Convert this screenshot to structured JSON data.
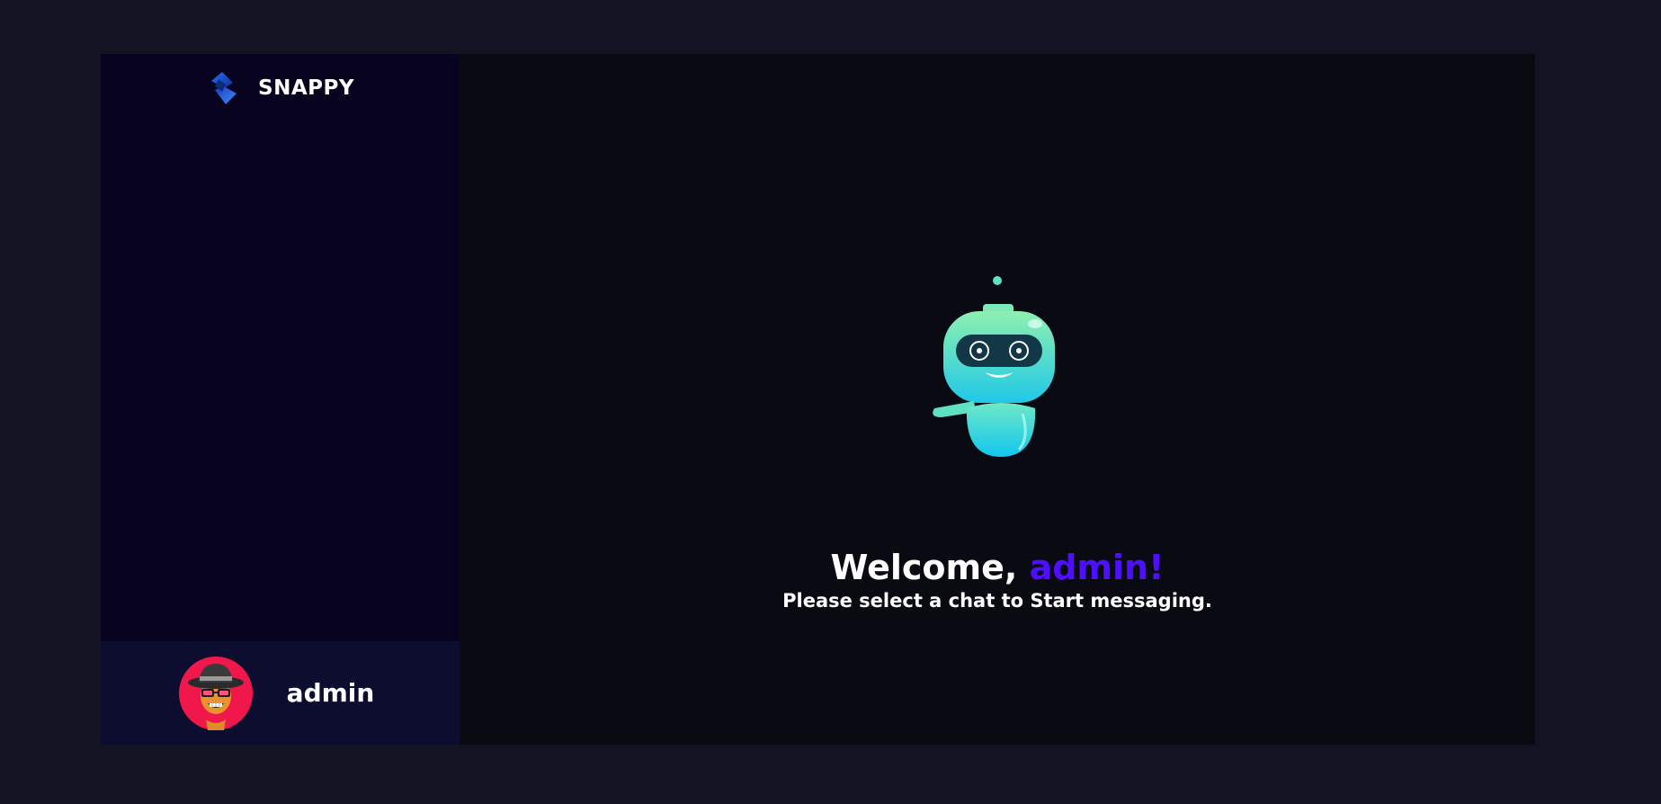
{
  "brand": {
    "name": "snappy",
    "logo_icon": "snappy-logo-icon"
  },
  "current_user": {
    "username": "admin",
    "avatar_icon": "user-avatar-icon"
  },
  "welcome": {
    "greeting": "Welcome,",
    "name": "admin!",
    "subtitle": "Please select a chat to Start messaging.",
    "illustration_icon": "robot-icon"
  },
  "colors": {
    "page_background": "#131324",
    "sidebar_background": "#080420",
    "user_panel_background": "#0d0d30",
    "chat_background": "#0a0a13",
    "accent": "#4e0eff",
    "avatar_red": "#f0184a",
    "robot_teal": "#5be3c2"
  }
}
